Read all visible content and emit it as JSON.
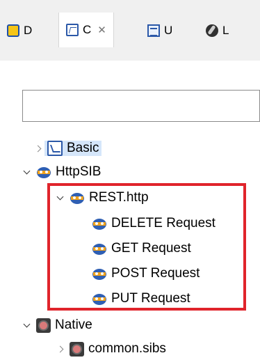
{
  "tabs": [
    {
      "label": "D",
      "icon": "diagram-icon"
    },
    {
      "label": "C",
      "icon": "component-icon",
      "active": true,
      "close": "✕"
    },
    {
      "label": "U",
      "icon": "ui-icon"
    },
    {
      "label": "L",
      "icon": "library-icon"
    }
  ],
  "search": {
    "value": "",
    "placeholder": ""
  },
  "tree": {
    "basic": "Basic",
    "httpsib": "HttpSIB",
    "rest_http": "REST.http",
    "delete_request": "DELETE Request",
    "get_request": "GET Request",
    "post_request": "POST Request",
    "put_request": "PUT Request",
    "native": "Native",
    "common_sibs": "common.sibs"
  },
  "colors": {
    "highlight": "#e0242b",
    "selection": "#d5e6fa",
    "sib_blue": "#2f5fb3",
    "sib_orange": "#f2a31b"
  }
}
